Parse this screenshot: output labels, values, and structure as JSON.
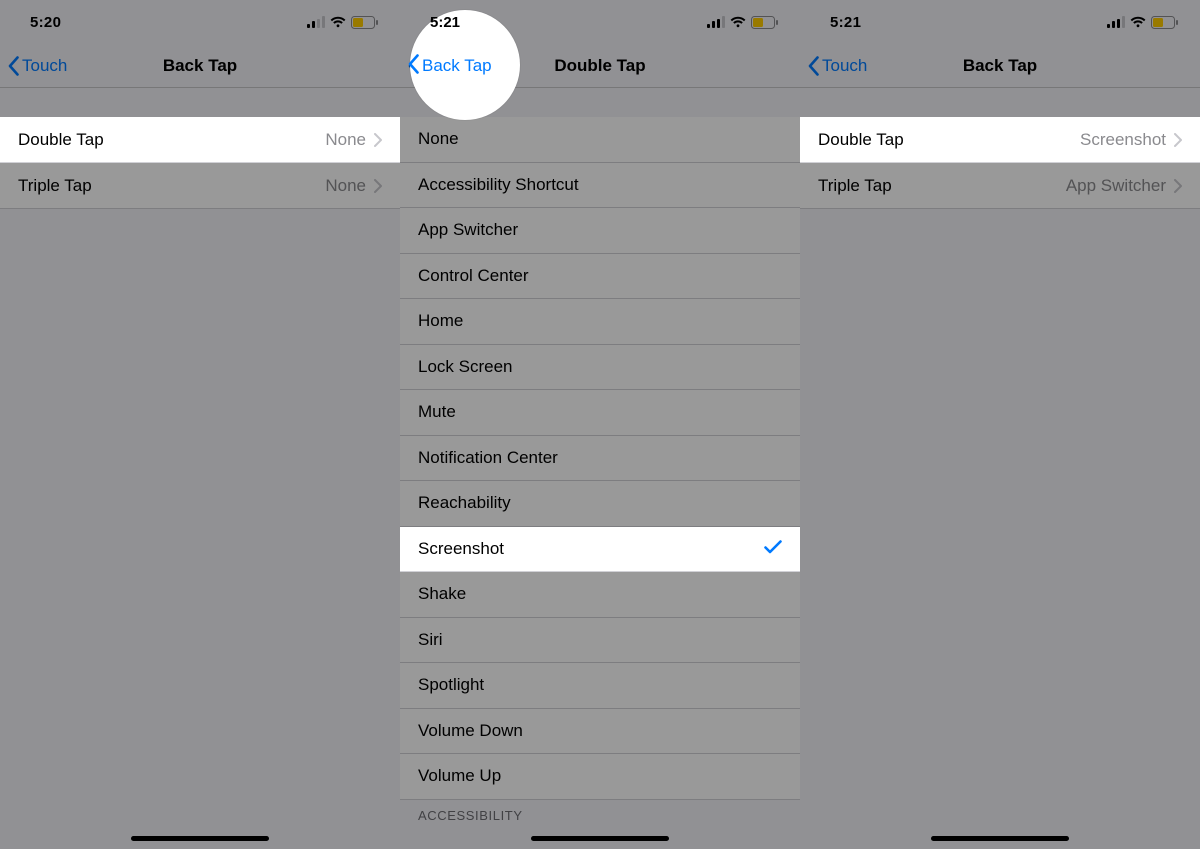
{
  "status_time_1": "5:20",
  "status_time_2": "5:21",
  "status_time_3": "5:21",
  "panel1": {
    "back_label": "Touch",
    "title": "Back Tap",
    "rows": [
      {
        "label": "Double Tap",
        "value": "None"
      },
      {
        "label": "Triple Tap",
        "value": "None"
      }
    ]
  },
  "panel2": {
    "back_label": "Back Tap",
    "title": "Double Tap",
    "options": [
      "None",
      "Accessibility Shortcut",
      "App Switcher",
      "Control Center",
      "Home",
      "Lock Screen",
      "Mute",
      "Notification Center",
      "Reachability",
      "Screenshot",
      "Shake",
      "Siri",
      "Spotlight",
      "Volume Down",
      "Volume Up"
    ],
    "selected_index": 9,
    "section2_header": "ACCESSIBILITY"
  },
  "panel3": {
    "back_label": "Touch",
    "title": "Back Tap",
    "rows": [
      {
        "label": "Double Tap",
        "value": "Screenshot"
      },
      {
        "label": "Triple Tap",
        "value": "App Switcher"
      }
    ]
  }
}
